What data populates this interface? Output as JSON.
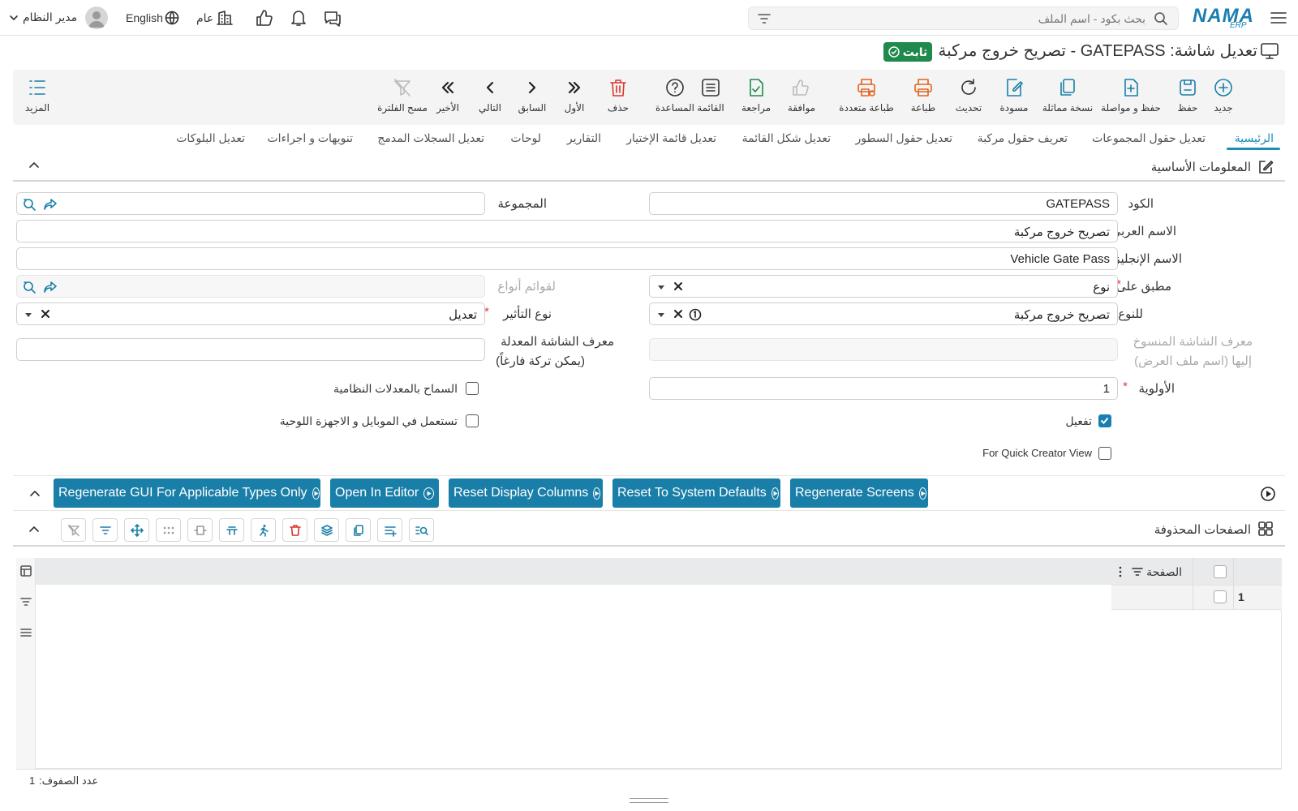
{
  "topbar": {
    "logo_text": "NAMA",
    "logo_sub": "ERP",
    "search_placeholder": "بحث بكود - اسم الملف",
    "user_name": "مدير النظام",
    "language": "English",
    "branch": "عام"
  },
  "page": {
    "title": "تعديل شاشة: GATEPASS - تصريح خروج مركبة",
    "status": "ثابت"
  },
  "toolbar": {
    "new": "جديد",
    "save": "حفظ",
    "save_continue": "حفظ و مواصلة",
    "copy": "نسخة مماثلة",
    "draft": "مسودة",
    "refresh": "تحديث",
    "print": "طباعة",
    "multi_print": "طباعة متعددة",
    "approve": "موافقة",
    "review": "مراجعة",
    "list": "القائمة",
    "help": "المساعدة",
    "delete": "حذف",
    "first": "الأول",
    "previous": "السابق",
    "next": "التالي",
    "last": "الأخير",
    "clear_filter": "مسح الفلترة",
    "more": "المزيد"
  },
  "tabs": [
    "الرئيسية",
    "تعديل حقول المجموعات",
    "تعريف حقول مركبة",
    "تعديل حقول السطور",
    "تعديل شكل القائمة",
    "تعديل قائمة الإختيار",
    "التقارير",
    "لوحات",
    "تعديل السجلات المدمج",
    "تنويهات و اجراءات",
    "تعديل البلوكات"
  ],
  "basic_info": {
    "section_title": "المعلومات الأساسية",
    "code_label": "الكود",
    "code_value": "GATEPASS",
    "group_label": "المجموعة",
    "arabic_name_label": "الاسم العربي",
    "arabic_name_value": "تصريح خروج مركبة",
    "english_name_label": "الاسم الإنجليزي",
    "english_name_value": "Vehicle Gate Pass",
    "applied_on_label": "مطبق على",
    "applied_on_value": "نوع",
    "type_lists_label": "لقوائم أنواع",
    "for_type_label": "للنوع",
    "for_type_value": "تصريح خروج مركبة",
    "effect_type_label": "نوع التأثير",
    "effect_type_value": "تعديل",
    "copied_screen_label_1": "معرف الشاشة المنسوخ",
    "copied_screen_label_2": "إليها (اسم ملف العرض)",
    "modified_screen_label_1": "معرف الشاشة المعدلة",
    "modified_screen_label_2": "(يمكن تركة فارغاً)",
    "priority_label": "الأولوية",
    "priority_value": "1",
    "allow_system_mods_label": "السماح بالمعدلات النظامية",
    "activate_label": "تفعيل",
    "mobile_label": "تستعمل في الموبايل و الاجهزة اللوحية",
    "quick_creator_label": "For Quick Creator View",
    "activate_checked": true
  },
  "actions": {
    "regenerate_gui": "Regenerate GUI For Applicable Types Only",
    "open_editor": "Open In Editor",
    "reset_display": "Reset Display Columns",
    "reset_defaults": "Reset To System Defaults",
    "regenerate_screens": "Regenerate Screens"
  },
  "deleted_pages": {
    "section_title": "الصفحات المحذوفة",
    "column_page": "الصفحة",
    "row_number": "1",
    "row_count_label": "عدد الصفوف:",
    "row_count": "1"
  },
  "colors": {
    "accent": "#1a7fa8",
    "status_green": "#1f8a4c",
    "required": "#e23b3b"
  }
}
